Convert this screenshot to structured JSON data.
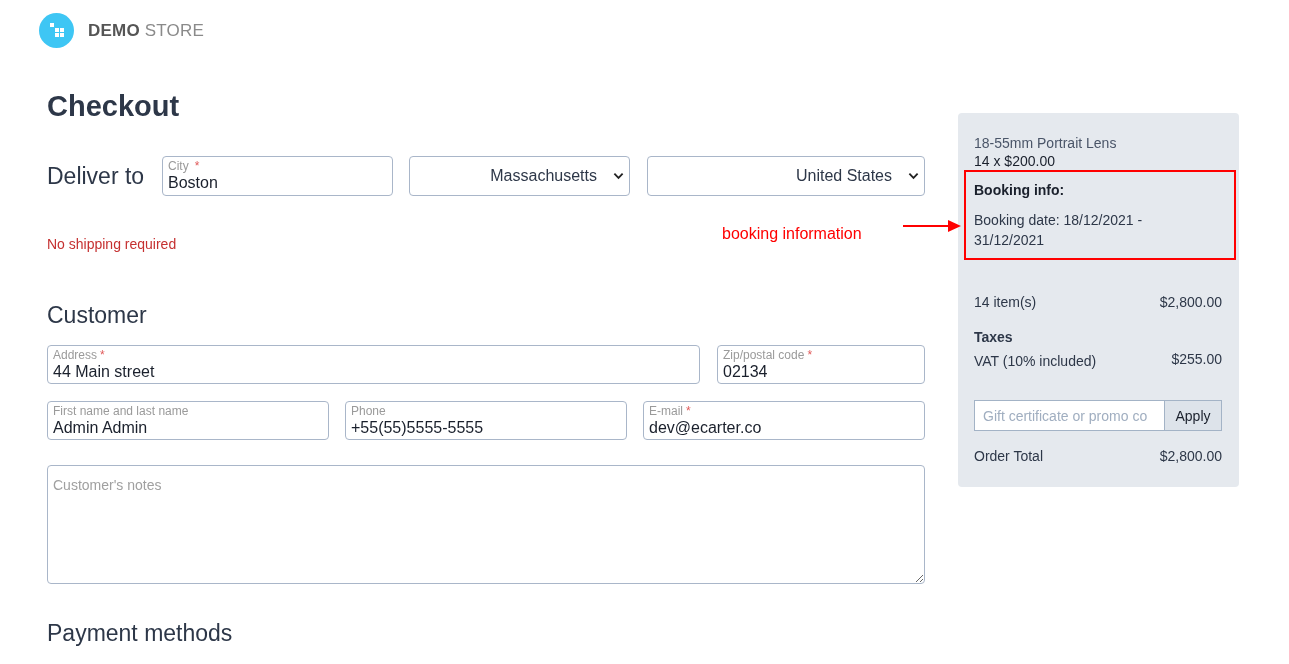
{
  "header": {
    "logo_text": "**DEMO** STORE"
  },
  "page": {
    "title": "Checkout"
  },
  "delivery": {
    "label": "Deliver to",
    "city": {
      "label": "City",
      "required_mark": "*",
      "value": "Boston"
    },
    "state": {
      "value": "Massachusetts"
    },
    "country": {
      "value": "United States"
    },
    "shipping_note": "No shipping required"
  },
  "customer": {
    "heading": "Customer",
    "rows": [
      {
        "fields": [
          {
            "label": "Address",
            "required_mark": "*",
            "value": "44 Main street"
          },
          {
            "label": "Zip/postal code",
            "required_mark": "*",
            "value": "02134"
          }
        ]
      },
      {
        "fields": [
          {
            "label": "First name and last name",
            "value": "Admin Admin"
          },
          {
            "label": "Phone",
            "value": "+55(55)5555-5555"
          },
          {
            "label": "E-mail",
            "required_mark": "*",
            "value": "dev@ecarter.co"
          }
        ]
      }
    ],
    "notes": {
      "placeholder": "Customer's notes"
    }
  },
  "payment": {
    "heading": "Payment methods"
  },
  "summary": {
    "items": [
      {
        "name": "18-55mm Portrait Lens",
        "quantity_price": "14 x $200.00",
        "booking": {
          "highlighted": true,
          "heading": "Booking info:",
          "dates": "Booking date: 18/12/2021 - 31/12/2021"
        }
      }
    ],
    "subtotal": {
      "label": "14 item(s)",
      "amount": "$2,800.00"
    },
    "taxes": {
      "heading": "Taxes",
      "lines": [
        {
          "label": "VAT (10% included)",
          "amount": "$255.00"
        }
      ]
    },
    "promo": {
      "placeholder": "Gift certificate or promo co",
      "button": "Apply"
    },
    "total": {
      "label": "Order Total",
      "amount": "$2,800.00"
    }
  },
  "annotation": {
    "label": "booking information"
  }
}
